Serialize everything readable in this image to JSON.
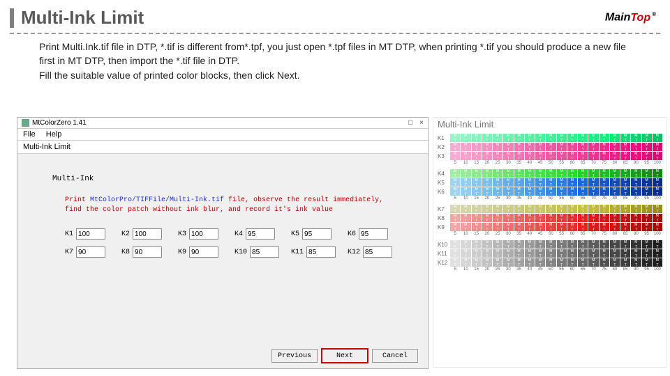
{
  "title": "Multi-Ink Limit",
  "logo_main": "Main",
  "logo_top": "Top",
  "description": "Print Multi.Ink.tif file in DTP,  *.tif is different from*.tpf, you just open *.tpf files in MT DTP, when printing *.tif  you should produce a new file first in MT DTP, then import the *.tif file in DTP.\nFill the suitable value of printed color blocks, then click Next.",
  "window": {
    "title": "MtColorZero 1.41",
    "menu_file": "File",
    "menu_help": "Help",
    "breadcrumb": "Multi-Ink Limit",
    "panel_title": "Multi-Ink",
    "instruction_prefix": "Print ",
    "instruction_path": "MtColorPro/TIFFile/Multi-Ink.tif",
    "instruction_mid": " file, observe the result immediately, find the color patch without ink blur, and record it's ink value",
    "fields": [
      {
        "label": "K1",
        "value": "100"
      },
      {
        "label": "K2",
        "value": "100"
      },
      {
        "label": "K3",
        "value": "100"
      },
      {
        "label": "K4",
        "value": "95"
      },
      {
        "label": "K5",
        "value": "95"
      },
      {
        "label": "K6",
        "value": "95"
      },
      {
        "label": "K7",
        "value": "90"
      },
      {
        "label": "K8",
        "value": "90"
      },
      {
        "label": "K9",
        "value": "90"
      },
      {
        "label": "K10",
        "value": "85"
      },
      {
        "label": "K11",
        "value": "85"
      },
      {
        "label": "K12",
        "value": "85"
      }
    ],
    "btn_prev": "Previous",
    "btn_next": "Next",
    "btn_cancel": "Cancel",
    "close": "×",
    "max": "□"
  },
  "chart_data": {
    "type": "table",
    "title": "Multi-Ink Limit",
    "axis": [
      "5",
      "10",
      "15",
      "20",
      "25",
      "30",
      "35",
      "40",
      "45",
      "50",
      "55",
      "60",
      "65",
      "70",
      "75",
      "80",
      "85",
      "90",
      "95",
      "100"
    ],
    "rows": [
      {
        "label": "K1",
        "h1": 150,
        "s1": 80,
        "l1": 78,
        "h2": 150,
        "s2": 90,
        "l2": 40
      },
      {
        "label": "K2",
        "h1": 330,
        "s1": 80,
        "l1": 82,
        "h2": 330,
        "s2": 90,
        "l2": 45
      },
      {
        "label": "K3",
        "h1": 330,
        "s1": 80,
        "l1": 82,
        "h2": 330,
        "s2": 90,
        "l2": 45
      },
      {
        "label": "K4",
        "h1": 120,
        "s1": 70,
        "l1": 78,
        "h2": 120,
        "s2": 80,
        "l2": 30
      },
      {
        "label": "K5",
        "h1": 200,
        "s1": 70,
        "l1": 78,
        "h2": 225,
        "s2": 85,
        "l2": 30
      },
      {
        "label": "K6",
        "h1": 200,
        "s1": 70,
        "l1": 78,
        "h2": 225,
        "s2": 85,
        "l2": 30
      },
      {
        "label": "K7",
        "h1": 60,
        "s1": 30,
        "l1": 78,
        "h2": 55,
        "s2": 70,
        "l2": 35
      },
      {
        "label": "K8",
        "h1": 0,
        "s1": 75,
        "l1": 80,
        "h2": 0,
        "s2": 85,
        "l2": 35
      },
      {
        "label": "K9",
        "h1": 0,
        "s1": 75,
        "l1": 80,
        "h2": 0,
        "s2": 85,
        "l2": 35
      },
      {
        "label": "K10",
        "h1": 0,
        "s1": 0,
        "l1": 88,
        "h2": 0,
        "s2": 0,
        "l2": 12
      },
      {
        "label": "K11",
        "h1": 0,
        "s1": 0,
        "l1": 88,
        "h2": 0,
        "s2": 0,
        "l2": 12
      },
      {
        "label": "K12",
        "h1": 0,
        "s1": 0,
        "l1": 88,
        "h2": 0,
        "s2": 0,
        "l2": 12
      }
    ]
  }
}
